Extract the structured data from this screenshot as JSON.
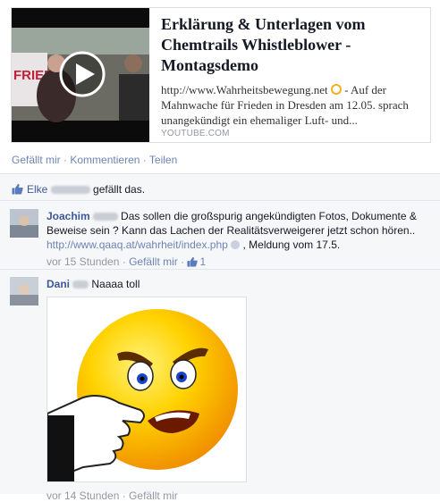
{
  "share": {
    "title": "Erklärung & Unterlagen vom Chemtrails Whistleblower - Montagsdemo",
    "desc_prefix": "http://www.Wahrheitsbewegung.net",
    "desc_suffix": " - Auf der Mahnwache für Frieden in Dresden am 12.05. sprach unangekündigt ein ehemaliger Luft- und...",
    "source": "YOUTUBE.COM",
    "thumb_text": "FRIED"
  },
  "post_actions": {
    "like": "Gefällt mir",
    "comment": "Kommentieren",
    "share": "Teilen",
    "separator": "·"
  },
  "likes_sentence": {
    "name": "Elke",
    "suffix": " gefällt das."
  },
  "comments": [
    {
      "author": "Joachim",
      "text_before_link": " Das sollen die großspurig angekündigten Fotos, Dokumente & Beweise sein ? Kann das Lachen der Realitätsverweigerer jetzt schon hören..",
      "link": "http://www.qaaq.at/wahrheit/index.php",
      "text_after_link": " , Meldung vom 17.5.",
      "time": "vor 15 Stunden",
      "like": "Gefällt mir",
      "like_count": "1"
    },
    {
      "author": "Dani",
      "text": " Naaaa toll"
    }
  ],
  "bottom_meta": "vor 14 Stunden · Gefällt mir",
  "colors": {
    "link": "#3b5998",
    "muted": "#9197a3",
    "ufi_bg": "#f6f7f9",
    "smiley": "#f7c200"
  }
}
